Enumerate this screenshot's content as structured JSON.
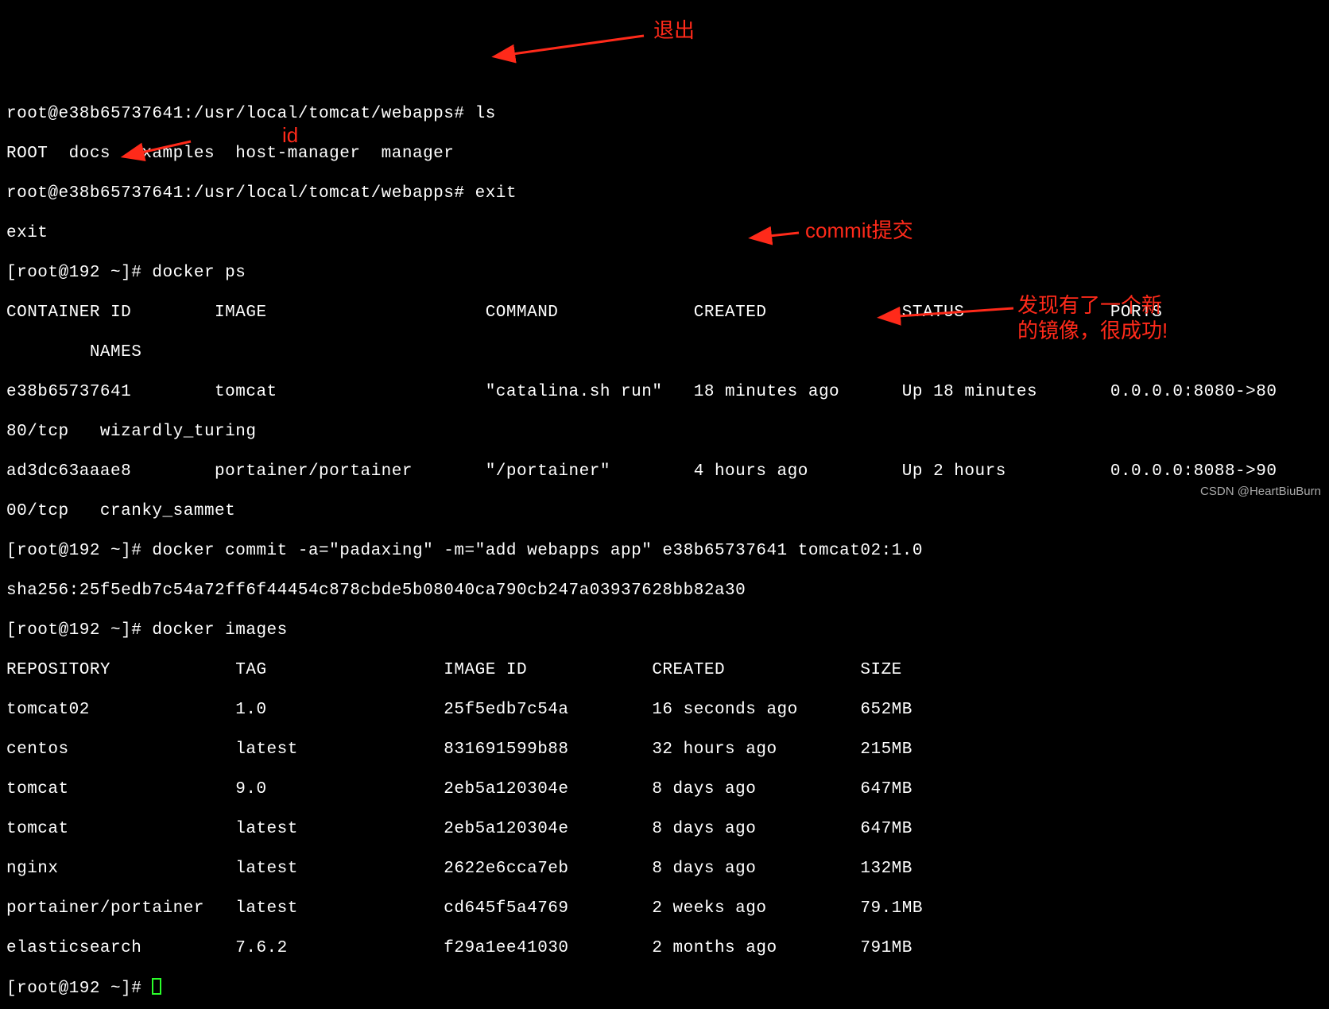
{
  "lines": {
    "l1": "root@e38b65737641:/usr/local/tomcat/webapps# ls",
    "l2": "ROOT  docs  examples  host-manager  manager",
    "l3": "root@e38b65737641:/usr/local/tomcat/webapps# exit",
    "l4": "exit",
    "l5": "[root@192 ~]# docker ps",
    "ps_header": "CONTAINER ID        IMAGE                 COMMAND             CREATED             STATUS              PORTS",
    "ps_names": "        NAMES",
    "ps_row1a": "e38b65737641        tomcat                \"catalina.sh run\"   18 minutes ago      Up 18 minutes       0.0.0.0:8080->80",
    "ps_row1b": "80/tcp   wizardly_turing",
    "ps_row2a": "ad3dc63aaae8        portainer/portainer   \"/portainer\"        4 hours ago         Up 2 hours          0.0.0.0:8088->90",
    "ps_row2b": "00/tcp   cranky_sammet",
    "commit_cmd": "[root@192 ~]# docker commit -a=\"padaxing\" -m=\"add webapps app\" e38b65737641 tomcat02:1.0",
    "commit_sha": "sha256:25f5edb7c54a72ff6f44454c878cbde5b08040ca790cb247a03937628bb82a30",
    "images_cmd": "[root@192 ~]# docker images",
    "img_header": "REPOSITORY            TAG                 IMAGE ID            CREATED             SIZE",
    "img_r1": "tomcat02              1.0                 25f5edb7c54a        16 seconds ago      652MB",
    "img_r2": "centos                latest              831691599b88        32 hours ago        215MB",
    "img_r3": "tomcat                9.0                 2eb5a120304e        8 days ago          647MB",
    "img_r4": "tomcat                latest              2eb5a120304e        8 days ago          647MB",
    "img_r5": "nginx                 latest              2622e6cca7eb        8 days ago          132MB",
    "img_r6": "portainer/portainer   latest              cd645f5a4769        2 weeks ago         79.1MB",
    "img_r7": "elasticsearch         7.6.2               f29a1ee41030        2 months ago        791MB",
    "final_prompt": "[root@192 ~]# "
  },
  "annotations": {
    "exit": "退出",
    "id": "id",
    "commit": "commit提交",
    "newimage": "发现有了一个新的镜像，很成功!"
  },
  "watermark": "CSDN @HeartBiuBurn"
}
